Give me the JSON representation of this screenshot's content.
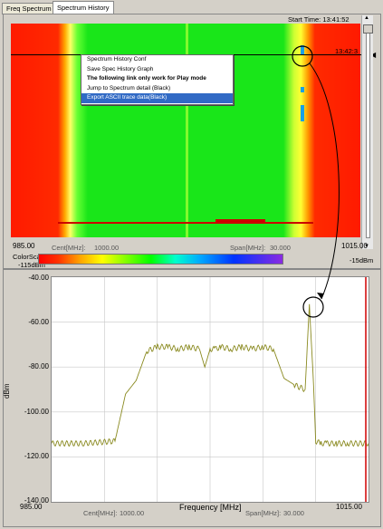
{
  "tabs": [
    {
      "label": "Freq Spectrum",
      "active": false
    },
    {
      "label": "Spectrum History",
      "active": true
    }
  ],
  "start_time": "Start Time: 13:41:52",
  "marker_time": "13:42:3",
  "context_menu": {
    "items": [
      {
        "label": "Spectrum History Conf",
        "bold": false,
        "selected": false
      },
      {
        "label": "Save Spec History Graph",
        "bold": false,
        "selected": false
      },
      {
        "label": "The following link only work for Play mode",
        "bold": true,
        "selected": false
      },
      {
        "label": "Jump to Spectrum detail (Black)",
        "bold": false,
        "selected": false
      },
      {
        "label": "Export ASCII trace data(Black)",
        "bold": false,
        "selected": true
      }
    ]
  },
  "waterfall": {
    "freq_start": "985.00",
    "freq_end": "1015.00",
    "cent_label": "Cent[MHz]:",
    "cent_value": "1000.00",
    "span_label": "Span[MHz]:",
    "span_value": "30.000",
    "colorscale_label": "ColorScale:",
    "colorscale_min": "-115dBm",
    "colorscale_max": "-15dBm"
  },
  "spectrum": {
    "ylabel": "dBm",
    "xlabel": "Frequency [MHz]",
    "freq_start": "985.00",
    "freq_end": "1015.00",
    "cent_label": "Cent[MHz]:",
    "cent_value": "1000.00",
    "span_label": "Span[MHz]:",
    "span_value": "30.000",
    "yticks": [
      "-40.00",
      "-60.00",
      "-80.00",
      "-100.00",
      "-120.00",
      "-140.00"
    ]
  },
  "chart_data": {
    "type": "line",
    "xlim": [
      985,
      1015
    ],
    "ylim": [
      -140,
      -40
    ],
    "grid": true,
    "x": [
      985,
      988,
      991,
      992,
      993,
      994,
      995,
      996,
      997,
      998,
      999,
      999.5,
      1000,
      1000.5,
      1001,
      1002,
      1003,
      1004,
      1005,
      1006,
      1007,
      1008,
      1009,
      1009.4,
      1009.8,
      1010,
      1010.5,
      1011,
      1012,
      1013,
      1015
    ],
    "y": [
      -114,
      -114,
      -113,
      -92,
      -86,
      -73,
      -71,
      -71,
      -72,
      -71,
      -72,
      -80,
      -72,
      -72,
      -71,
      -72,
      -71,
      -72,
      -71,
      -72,
      -85,
      -88,
      -90,
      -52,
      -88,
      -113,
      -114,
      -114,
      -114,
      -114,
      -114
    ],
    "marker_x": 1015
  },
  "colors": {
    "wf_red": "#ff1a00",
    "wf_green": "#19e619",
    "trace": "#8a8a20",
    "marker_line": "#d00000",
    "menu_select": "#316ac5"
  }
}
